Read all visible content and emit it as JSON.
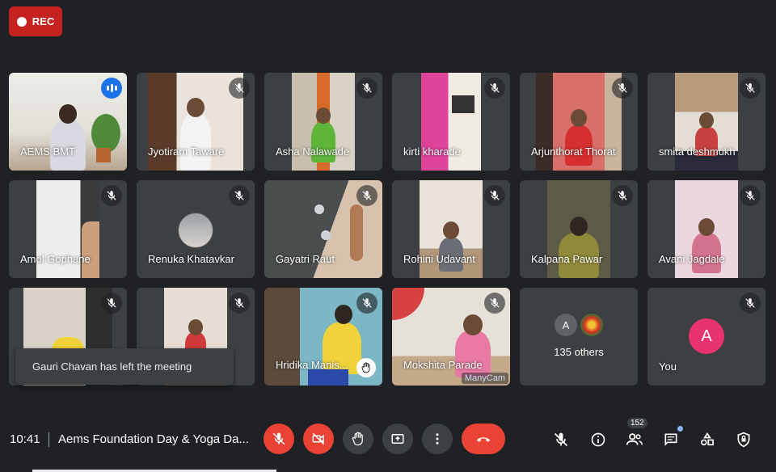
{
  "recording": {
    "label": "REC",
    "color": "#c5221f"
  },
  "participants": [
    {
      "name": "AEMS BMT",
      "speaking": true
    },
    {
      "name": "Jyotiram Taware",
      "muted": true
    },
    {
      "name": "Asha Nalawade",
      "muted": true
    },
    {
      "name": "kirti kharade",
      "muted": true
    },
    {
      "name": "Arjunthorat Thorat",
      "muted": true
    },
    {
      "name": "smita deshmukh",
      "muted": true
    },
    {
      "name": "Amol Gophane",
      "muted": true
    },
    {
      "name": "Renuka Khatavkar",
      "muted": true
    },
    {
      "name": "Gayatri Raut",
      "muted": true
    },
    {
      "name": "Rohini Udavant",
      "muted": true
    },
    {
      "name": "Kalpana Pawar",
      "muted": true
    },
    {
      "name": "Avani Jagdale",
      "muted": true
    },
    {
      "name": "",
      "muted": true
    },
    {
      "name": "",
      "muted": true
    },
    {
      "name": "Hridika Manis...",
      "muted": true,
      "hand_raised": true
    },
    {
      "name": "Mokshita Parade",
      "muted": true,
      "watermark": "ManyCam"
    },
    {
      "name": "135 others",
      "avatar_letter": "A"
    },
    {
      "name": "You",
      "avatar_letter": "A",
      "muted": true
    }
  ],
  "toast": {
    "message": "Gauri Chavan has left the meeting"
  },
  "bottom_bar": {
    "time": "10:41",
    "meeting_title": "Aems Foundation Day & Yoga Da...",
    "controls": [
      "mic-off-icon",
      "camera-off-icon",
      "raise-hand-icon",
      "present-icon",
      "more-options-icon",
      "end-call-icon"
    ],
    "people_count": "152",
    "right_icons": [
      "host-mic-icon",
      "info-icon",
      "people-icon",
      "chat-icon",
      "activities-icon",
      "host-controls-icon"
    ]
  },
  "colors": {
    "background": "#202124",
    "tile": "#3c4043",
    "danger": "#ea4335",
    "speaking": "#1a73e8",
    "avatar_you": "#e8336f"
  }
}
